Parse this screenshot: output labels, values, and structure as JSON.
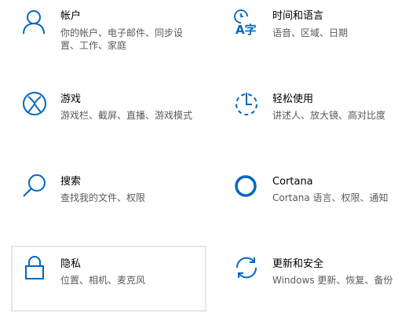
{
  "accent_color": "#0067c0",
  "tiles": [
    {
      "id": "accounts",
      "title": "帐户",
      "desc_line1": "你的帐户、电子邮件、同步设",
      "desc_line2": "置、工作、家庭",
      "icon": "person-icon"
    },
    {
      "id": "time-language",
      "title": "时间和语言",
      "desc_line1": "语音、区域、日期",
      "icon": "time-language-icon",
      "icon_glyph": "A字"
    },
    {
      "id": "gaming",
      "title": "游戏",
      "desc_line1": "游戏栏、截屏、直播、游戏模式",
      "icon": "xbox-icon"
    },
    {
      "id": "ease-of-access",
      "title": "轻松使用",
      "desc_line1": "讲述人、放大镜、高对比度",
      "icon": "ease-of-access-icon"
    },
    {
      "id": "search",
      "title": "搜索",
      "desc_line1": "查找我的文件、权限",
      "icon": "search-icon"
    },
    {
      "id": "cortana",
      "title": "Cortana",
      "desc_line1": "Cortana 语言、权限、通知",
      "icon": "cortana-icon"
    },
    {
      "id": "privacy",
      "title": "隐私",
      "desc_line1": "位置、相机、麦克风",
      "icon": "lock-icon",
      "hovered": true
    },
    {
      "id": "update-security",
      "title": "更新和安全",
      "desc_line1": "Windows 更新、恢复、备份",
      "icon": "update-sync-icon"
    }
  ]
}
